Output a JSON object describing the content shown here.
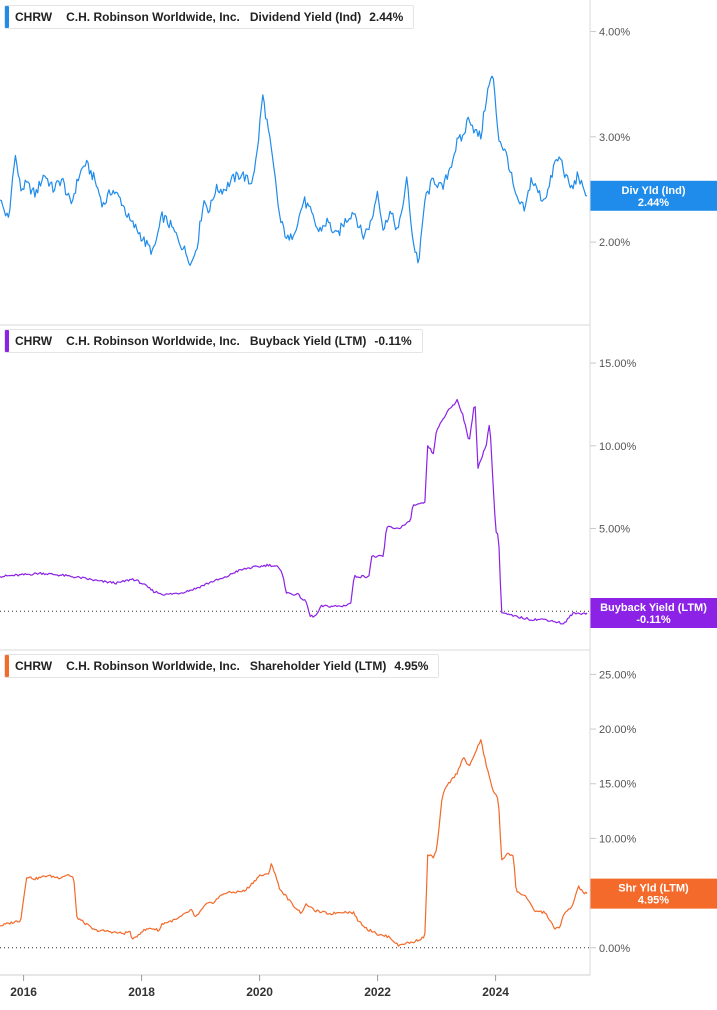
{
  "ticker": "CHRW",
  "company": "C.H. Robinson Worldwide, Inc.",
  "chart_data": [
    {
      "type": "line",
      "metric": "Dividend Yield (Ind)",
      "legend_value": "2.44%",
      "badge": [
        "Div Yld (Ind)",
        "2.44%"
      ],
      "color": "#1f8ceb",
      "yticks": [
        {
          "v": 2.0,
          "label": "2.00%"
        },
        {
          "v": 3.0,
          "label": "3.00%"
        },
        {
          "v": 4.0,
          "label": "4.00%"
        }
      ],
      "xlim": [
        2015.6,
        2025.6
      ],
      "ylim": [
        1.45,
        4.3
      ],
      "zero_line": false,
      "x": [
        2015.6,
        2015.75,
        2015.85,
        2015.95,
        2016.05,
        2016.2,
        2016.35,
        2016.5,
        2016.65,
        2016.8,
        2016.95,
        2017.05,
        2017.2,
        2017.35,
        2017.5,
        2017.65,
        2017.8,
        2017.95,
        2018.05,
        2018.2,
        2018.35,
        2018.5,
        2018.65,
        2018.75,
        2018.85,
        2018.95,
        2019.05,
        2019.15,
        2019.25,
        2019.4,
        2019.55,
        2019.7,
        2019.85,
        2019.95,
        2020.05,
        2020.15,
        2020.25,
        2020.35,
        2020.5,
        2020.65,
        2020.75,
        2020.85,
        2021.0,
        2021.15,
        2021.3,
        2021.45,
        2021.6,
        2021.75,
        2021.9,
        2022.0,
        2022.1,
        2022.2,
        2022.35,
        2022.5,
        2022.6,
        2022.7,
        2022.8,
        2022.95,
        2023.1,
        2023.25,
        2023.35,
        2023.45,
        2023.55,
        2023.65,
        2023.75,
        2023.85,
        2023.95,
        2024.05,
        2024.2,
        2024.35,
        2024.5,
        2024.6,
        2024.7,
        2024.8,
        2024.9,
        2025.0,
        2025.1,
        2025.2,
        2025.3,
        2025.4,
        2025.5,
        2025.55
      ],
      "y": [
        2.4,
        2.2,
        2.85,
        2.5,
        2.55,
        2.45,
        2.65,
        2.5,
        2.6,
        2.35,
        2.65,
        2.75,
        2.6,
        2.35,
        2.5,
        2.4,
        2.2,
        2.1,
        2.0,
        1.9,
        2.25,
        2.15,
        2.0,
        1.9,
        1.8,
        2.0,
        2.4,
        2.3,
        2.5,
        2.5,
        2.6,
        2.65,
        2.55,
        2.8,
        3.4,
        3.05,
        2.65,
        2.2,
        2.0,
        2.2,
        2.4,
        2.3,
        2.1,
        2.2,
        2.05,
        2.2,
        2.3,
        2.05,
        2.2,
        2.5,
        2.1,
        2.3,
        2.1,
        2.6,
        2.0,
        1.8,
        2.4,
        2.6,
        2.5,
        2.75,
        2.95,
        3.0,
        3.2,
        3.05,
        3.0,
        3.4,
        3.6,
        3.0,
        2.8,
        2.4,
        2.3,
        2.6,
        2.5,
        2.4,
        2.5,
        2.75,
        2.8,
        2.6,
        2.5,
        2.65,
        2.45,
        2.44
      ]
    },
    {
      "type": "line",
      "metric": "Buyback Yield (LTM)",
      "legend_value": "-0.11%",
      "badge": [
        "Buyback Yield (LTM)",
        "-0.11%"
      ],
      "color": "#8b22e6",
      "yticks": [
        {
          "v": 5,
          "label": "5.00%"
        },
        {
          "v": 10,
          "label": "10.00%"
        },
        {
          "v": 15,
          "label": "15.00%"
        }
      ],
      "xlim": [
        2015.6,
        2025.6
      ],
      "ylim": [
        -1.5,
        17
      ],
      "zero_line": true,
      "x": [
        2015.6,
        2016.0,
        2016.3,
        2016.7,
        2017.0,
        2017.3,
        2017.6,
        2017.85,
        2018.0,
        2018.2,
        2018.4,
        2018.65,
        2018.9,
        2019.2,
        2019.4,
        2019.6,
        2019.8,
        2020.0,
        2020.15,
        2020.3,
        2020.4,
        2020.45,
        2020.65,
        2020.8,
        2020.85,
        2020.95,
        2021.05,
        2021.4,
        2021.55,
        2021.6,
        2021.85,
        2021.9,
        2022.1,
        2022.15,
        2022.35,
        2022.55,
        2022.6,
        2022.8,
        2022.85,
        2022.95,
        2023.0,
        2023.1,
        2023.2,
        2023.3,
        2023.35,
        2023.45,
        2023.55,
        2023.65,
        2023.7,
        2023.85,
        2023.9,
        2024.0,
        2024.05,
        2024.1,
        2024.3,
        2024.6,
        2024.85,
        2025.1,
        2025.15,
        2025.3,
        2025.55
      ],
      "y": [
        2.1,
        2.2,
        2.3,
        2.15,
        2.0,
        1.8,
        1.7,
        1.95,
        1.7,
        1.2,
        1.0,
        1.1,
        1.35,
        1.8,
        2.0,
        2.4,
        2.6,
        2.7,
        2.8,
        2.7,
        2.2,
        1.1,
        1.0,
        0.5,
        -0.3,
        -0.3,
        0.3,
        0.3,
        0.5,
        2.1,
        2.1,
        3.3,
        3.3,
        5.1,
        5.0,
        5.4,
        6.4,
        6.5,
        10.0,
        9.5,
        11.0,
        11.5,
        12.2,
        12.5,
        12.8,
        11.8,
        10.2,
        12.8,
        8.6,
        10.2,
        11.5,
        4.9,
        4.6,
        -0.1,
        -0.3,
        -0.5,
        -0.5,
        -0.7,
        -0.8,
        -0.15,
        -0.11
      ]
    },
    {
      "type": "line",
      "metric": "Shareholder Yield (LTM)",
      "legend_value": "4.95%",
      "badge": [
        "Shr Yld (LTM)",
        "4.95%"
      ],
      "color": "#f36a2b",
      "yticks": [
        {
          "v": 0,
          "label": "0.00%"
        },
        {
          "v": 5,
          "label": "5.00%"
        },
        {
          "v": 10,
          "label": "10.00%"
        },
        {
          "v": 15,
          "label": "15.00%"
        },
        {
          "v": 20,
          "label": "20.00%"
        },
        {
          "v": 25,
          "label": "25.00%"
        }
      ],
      "xlim": [
        2015.6,
        2025.6
      ],
      "ylim": [
        -2.4,
        26.5
      ],
      "zero_line": true,
      "x": [
        2015.6,
        2015.8,
        2015.95,
        2016.05,
        2016.2,
        2016.4,
        2016.6,
        2016.75,
        2016.85,
        2016.9,
        2017.2,
        2017.45,
        2017.55,
        2017.7,
        2017.8,
        2017.85,
        2018.0,
        2018.15,
        2018.3,
        2018.35,
        2018.6,
        2018.85,
        2018.9,
        2019.1,
        2019.2,
        2019.4,
        2019.6,
        2019.75,
        2020.0,
        2020.15,
        2020.2,
        2020.25,
        2020.35,
        2020.45,
        2020.55,
        2020.7,
        2020.8,
        2020.9,
        2021.0,
        2021.2,
        2021.4,
        2021.6,
        2021.65,
        2021.85,
        2021.95,
        2022.0,
        2022.2,
        2022.35,
        2022.45,
        2022.6,
        2022.8,
        2022.85,
        2022.95,
        2023.0,
        2023.1,
        2023.2,
        2023.35,
        2023.45,
        2023.55,
        2023.65,
        2023.75,
        2023.85,
        2023.95,
        2024.05,
        2024.1,
        2024.2,
        2024.3,
        2024.35,
        2024.5,
        2024.65,
        2024.85,
        2025.0,
        2025.1,
        2025.15,
        2025.3,
        2025.4,
        2025.5,
        2025.55
      ],
      "y": [
        2.0,
        2.3,
        2.5,
        6.5,
        6.3,
        6.6,
        6.4,
        6.7,
        6.4,
        2.8,
        1.6,
        1.5,
        1.4,
        1.3,
        1.5,
        0.7,
        1.5,
        1.8,
        1.6,
        2.2,
        2.6,
        3.5,
        2.7,
        4.0,
        4.1,
        5.0,
        5.1,
        5.2,
        6.6,
        6.7,
        7.8,
        6.9,
        5.3,
        4.7,
        4.0,
        3.2,
        4.0,
        3.5,
        3.3,
        3.1,
        3.3,
        3.2,
        2.6,
        1.6,
        1.5,
        1.2,
        1.0,
        0.2,
        0.4,
        0.5,
        1.0,
        8.5,
        8.3,
        8.9,
        14.0,
        15.0,
        16.0,
        17.5,
        16.5,
        17.8,
        19.0,
        16.5,
        14.5,
        13.5,
        7.9,
        8.7,
        8.4,
        5.1,
        4.8,
        3.4,
        3.2,
        1.7,
        2.0,
        3.0,
        3.8,
        5.6,
        5.0,
        4.95
      ]
    }
  ],
  "x_axis": {
    "ticks": [
      {
        "v": 2016.0,
        "label": "2016"
      },
      {
        "v": 2018.0,
        "label": "2018"
      },
      {
        "v": 2020.0,
        "label": "2020"
      },
      {
        "v": 2022.0,
        "label": "2022"
      },
      {
        "v": 2024.0,
        "label": "2024"
      }
    ]
  }
}
